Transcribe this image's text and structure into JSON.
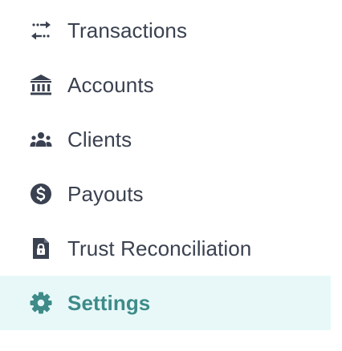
{
  "colors": {
    "text": "#3a4150",
    "active_text": "#3e8b89",
    "active_background": "#e8f8f8"
  },
  "nav": {
    "items": [
      {
        "label": "Transactions",
        "icon": "transfer-arrows-icon",
        "active": false
      },
      {
        "label": "Accounts",
        "icon": "bank-building-icon",
        "active": false
      },
      {
        "label": "Clients",
        "icon": "users-group-icon",
        "active": false
      },
      {
        "label": "Payouts",
        "icon": "dollar-circle-icon",
        "active": false
      },
      {
        "label": "Trust Reconciliation",
        "icon": "document-lock-icon",
        "active": false
      },
      {
        "label": "Settings",
        "icon": "gear-icon",
        "active": true
      }
    ]
  }
}
